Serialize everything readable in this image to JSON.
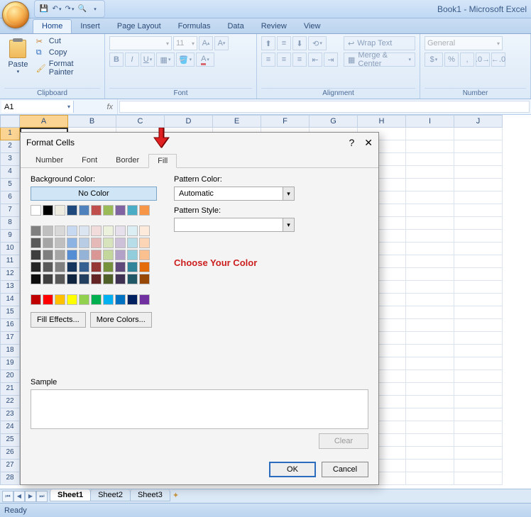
{
  "app": {
    "title": "Book1 - Microsoft Excel"
  },
  "ribbon_tabs": [
    "Home",
    "Insert",
    "Page Layout",
    "Formulas",
    "Data",
    "Review",
    "View"
  ],
  "ribbon_active_tab": "Home",
  "groups": {
    "clipboard": {
      "label": "Clipboard",
      "paste": "Paste",
      "cut": "Cut",
      "copy": "Copy",
      "format_painter": "Format Painter"
    },
    "font": {
      "label": "Font",
      "size": "11"
    },
    "alignment": {
      "label": "Alignment",
      "wrap": "Wrap Text",
      "merge": "Merge & Center"
    },
    "number": {
      "label": "Number",
      "format": "General"
    }
  },
  "namebox": "A1",
  "fx_label": "fx",
  "columns": [
    "A",
    "B",
    "C",
    "D",
    "E",
    "F",
    "G",
    "H",
    "I",
    "J"
  ],
  "rows": [
    1,
    2,
    3,
    4,
    5,
    6,
    7,
    8,
    9,
    10,
    11,
    12,
    13,
    14,
    15,
    16,
    17,
    18,
    19,
    20,
    21,
    22,
    23,
    24,
    25,
    26,
    27,
    28
  ],
  "sheet_tabs": [
    "Sheet1",
    "Sheet2",
    "Sheet3"
  ],
  "active_sheet": "Sheet1",
  "status": "Ready",
  "dialog": {
    "title": "Format Cells",
    "tabs": [
      "Number",
      "Font",
      "Border",
      "Fill"
    ],
    "active_tab": "Fill",
    "bg_label": "Background Color:",
    "no_color": "No Color",
    "fill_effects": "Fill Effects...",
    "more_colors": "More Colors...",
    "pattern_color_label": "Pattern Color:",
    "pattern_color_value": "Automatic",
    "pattern_style_label": "Pattern Style:",
    "annotation": "Choose Your Color",
    "sample": "Sample",
    "clear": "Clear",
    "ok": "OK",
    "cancel": "Cancel",
    "help": "?",
    "close": "✕",
    "palette_section1": [
      [
        "#ffffff",
        "#000000",
        "#eeece1",
        "#1f497d",
        "#4f81bd",
        "#c0504d",
        "#9bbb59",
        "#8064a2",
        "#4bacc6",
        "#f79646"
      ]
    ],
    "palette_section2": [
      [
        "#7f7f7f",
        "#bfbfbf",
        "#d8d8d8",
        "#c6d9f0",
        "#dbe5f1",
        "#f2dcdb",
        "#ebf1dd",
        "#e5e0ec",
        "#dbeef3",
        "#fdeada"
      ],
      [
        "#595959",
        "#a5a5a5",
        "#bfbfbf",
        "#8db3e2",
        "#b8cce4",
        "#e5b9b7",
        "#d7e3bc",
        "#ccc1d9",
        "#b7dde8",
        "#fbd5b5"
      ],
      [
        "#3f3f3f",
        "#7f7f7f",
        "#a5a5a5",
        "#548dd4",
        "#95b3d7",
        "#d99694",
        "#c3d69b",
        "#b2a2c7",
        "#92cddc",
        "#fac08f"
      ],
      [
        "#262626",
        "#595959",
        "#7f7f7f",
        "#17365d",
        "#366092",
        "#953734",
        "#76923c",
        "#5f497a",
        "#31859b",
        "#e36c09"
      ],
      [
        "#0c0c0c",
        "#3f3f3f",
        "#595959",
        "#0f243e",
        "#244061",
        "#632423",
        "#4f6128",
        "#3f3151",
        "#205867",
        "#974806"
      ]
    ],
    "palette_standard": [
      [
        "#c00000",
        "#ff0000",
        "#ffc000",
        "#ffff00",
        "#92d050",
        "#00b050",
        "#00b0f0",
        "#0070c0",
        "#002060",
        "#7030a0"
      ]
    ]
  }
}
